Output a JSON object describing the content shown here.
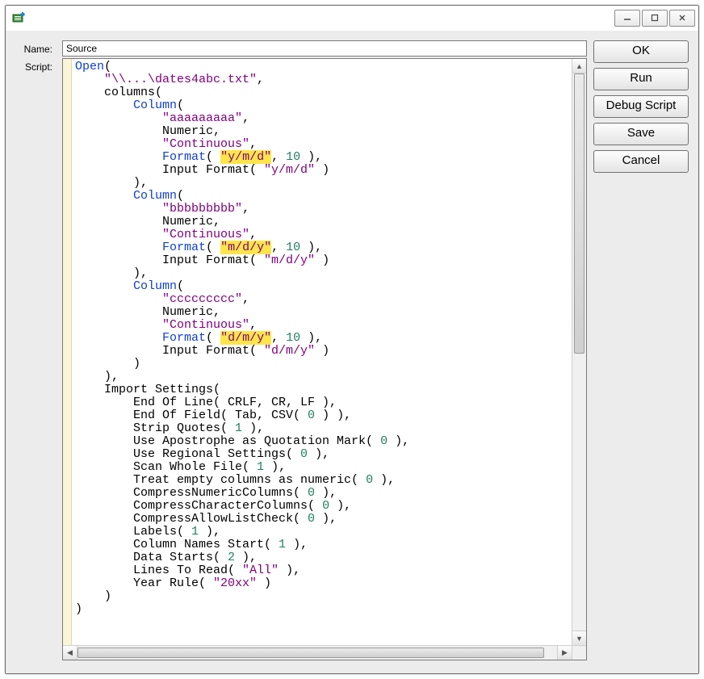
{
  "labels": {
    "name": "Name:",
    "script": "Script:"
  },
  "name_value": "Source",
  "buttons": {
    "ok": "OK",
    "run": "Run",
    "debug": "Debug Script",
    "save": "Save",
    "cancel": "Cancel"
  },
  "script": {
    "open_kw": "Open",
    "path": "\"\\\\...\\dates4abc.txt\"",
    "columns_kw": "columns",
    "column_kw": "Column",
    "numeric_kw": "Numeric",
    "continuous_str": "\"Continuous\"",
    "format_kw": "Format",
    "input_format_kw": "Input Format",
    "format_num": "10",
    "col1_name": "\"aaaaaaaaa\"",
    "col1_fmt": "\"y/m/d\"",
    "col1_ifmt": "\"y/m/d\"",
    "col2_name": "\"bbbbbbbbb\"",
    "col2_fmt": "\"m/d/y\"",
    "col2_ifmt": "\"m/d/y\"",
    "col3_name": "\"ccccccccc\"",
    "col3_fmt": "\"d/m/y\"",
    "col3_ifmt": "\"d/m/y\"",
    "import_settings_kw": "Import Settings",
    "eol": "End Of Line( CRLF, CR, LF ),",
    "eof_pre": "End Of Field( Tab, CSV( ",
    "eof_num": "0",
    "eof_post": " ) ),",
    "strip_pre": "Strip Quotes( ",
    "strip_num": "1",
    "close_comma": " ),",
    "apos_pre": "Use Apostrophe as Quotation Mark( ",
    "apos_num": "0",
    "reg_pre": "Use Regional Settings( ",
    "reg_num": "0",
    "scan_pre": "Scan Whole File( ",
    "scan_num": "1",
    "empty_pre": "Treat empty columns as numeric( ",
    "empty_num": "0",
    "cnc_pre": "CompressNumericColumns( ",
    "cnc_num": "0",
    "ccc_pre": "CompressCharacterColumns( ",
    "ccc_num": "0",
    "calc_pre": "CompressAllowListCheck( ",
    "calc_num": "0",
    "labels_pre": "Labels( ",
    "labels_num": "1",
    "cns_pre": "Column Names Start( ",
    "cns_num": "1",
    "ds_pre": "Data Starts( ",
    "ds_num": "2",
    "ltr_pre": "Lines To Read( ",
    "ltr_str": "\"All\"",
    "yr_pre": "Year Rule( ",
    "yr_str": "\"20xx\"",
    "close_paren": " )"
  }
}
